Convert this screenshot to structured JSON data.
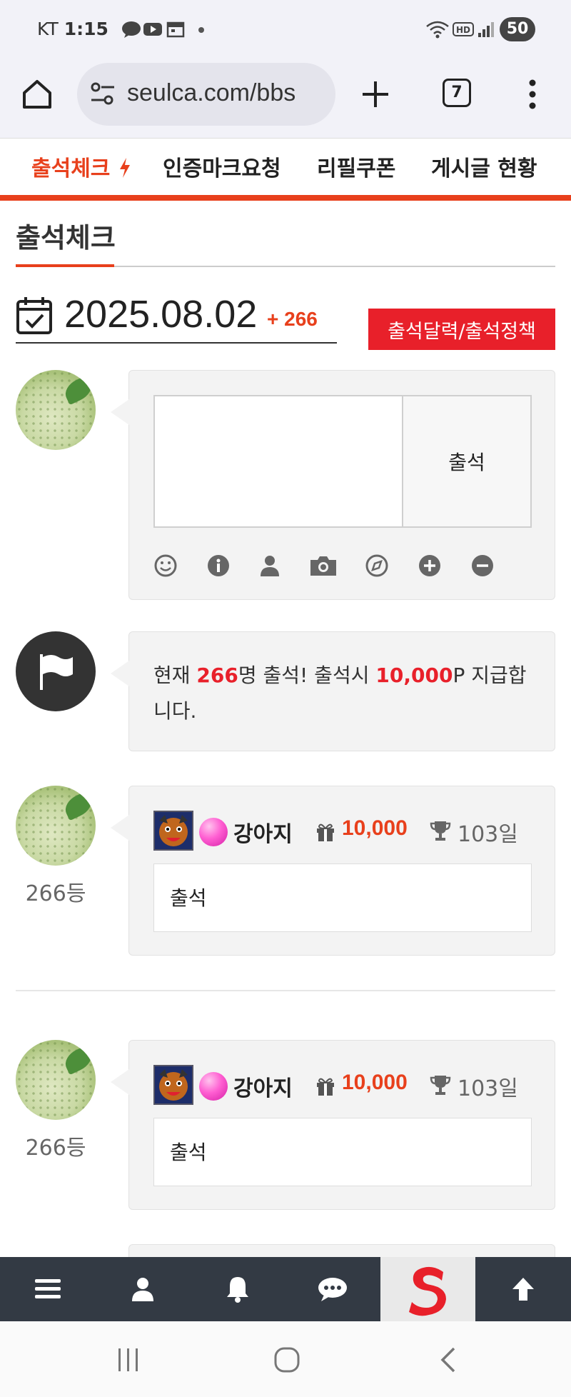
{
  "status_bar": {
    "carrier": "KT",
    "time": "1:15",
    "battery": "50"
  },
  "browser": {
    "url": "seulca.com/bbs",
    "tab_count": "7"
  },
  "tabs": [
    {
      "label": "출석체크",
      "active": true
    },
    {
      "label": "인증마크요청",
      "active": false
    },
    {
      "label": "리필쿠폰",
      "active": false
    },
    {
      "label": "게시글 현황",
      "active": false
    }
  ],
  "page": {
    "title": "출석체크",
    "date": "2025.08.02",
    "attend_count": "+ 266",
    "calendar_button": "출석달력/출석정책"
  },
  "form": {
    "submit_label": "출석"
  },
  "notice": {
    "prefix": "현재 ",
    "count": "266",
    "mid": "명 출석! 출석시 ",
    "points": "10,000",
    "suffix": "P 지급합니다."
  },
  "entries": [
    {
      "rank": "266등",
      "username": "강아지",
      "points": "10,000",
      "days": "103일",
      "comment": "출석"
    },
    {
      "rank": "266등",
      "username": "강아지",
      "points": "10,000",
      "days": "103일",
      "comment": "출석"
    }
  ],
  "colors": {
    "accent": "#e8401c",
    "red_button": "#e8202a",
    "bottom_bar": "#333a44"
  }
}
